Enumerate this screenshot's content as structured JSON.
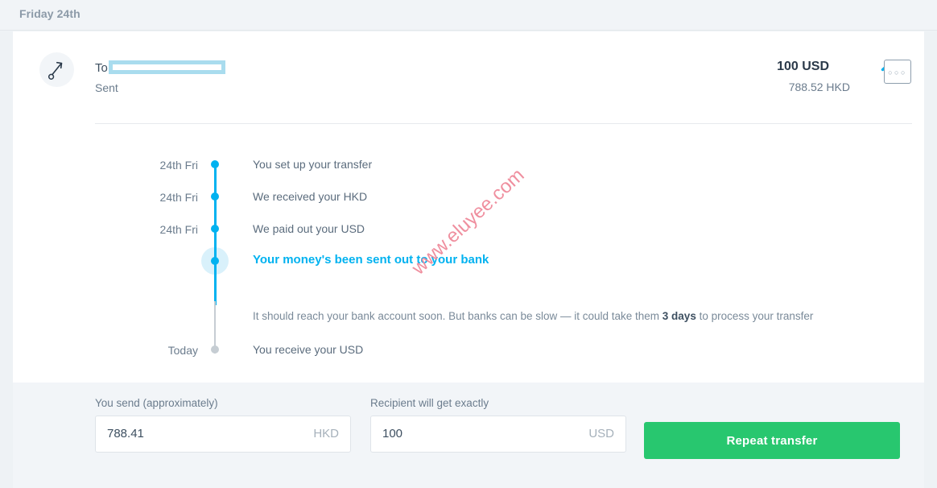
{
  "day_header": {
    "label": "Friday 24th"
  },
  "transaction": {
    "avatar_icon": "arrow-up-right-icon",
    "to_prefix": "To",
    "recipient_redacted": true,
    "recipient_suffix": "",
    "status": "Sent",
    "amount_main": "100 USD",
    "amount_sub": "788.52 HKD",
    "collapse_icon": "chevron-up-icon"
  },
  "more_menu": {
    "icon": "ellipsis-icon",
    "label": "○○○"
  },
  "timeline": {
    "steps": [
      {
        "date": "24th Fri",
        "text": "You set up your transfer",
        "state": "done"
      },
      {
        "date": "24th Fri",
        "text": "We received your HKD",
        "state": "done"
      },
      {
        "date": "24th Fri",
        "text": "We paid out your USD",
        "state": "done"
      },
      {
        "date": "",
        "text": "Your money's been sent out to your bank",
        "state": "current"
      },
      {
        "date": "Today",
        "text": "You receive your USD",
        "state": "pending"
      }
    ],
    "note_before": "It should reach your bank account soon. But banks can be slow — it could take them ",
    "note_highlight": "3 days",
    "note_after": " to process your transfer"
  },
  "watermark": {
    "text": "www.eluyee.com"
  },
  "footer": {
    "send": {
      "label": "You send (approximately)",
      "value": "788.41",
      "currency": "HKD",
      "placeholder": "0"
    },
    "receive": {
      "label": "Recipient will get exactly",
      "value": "100",
      "currency": "USD",
      "placeholder": "0"
    },
    "repeat_label": "Repeat transfer"
  },
  "colors": {
    "accent_blue": "#00b2f0",
    "green": "#28c76f",
    "redaction": "#a9dcee",
    "watermark": "#ef8a9a",
    "text_dark": "#3d4f60",
    "text_muted": "#6b7c8d"
  }
}
